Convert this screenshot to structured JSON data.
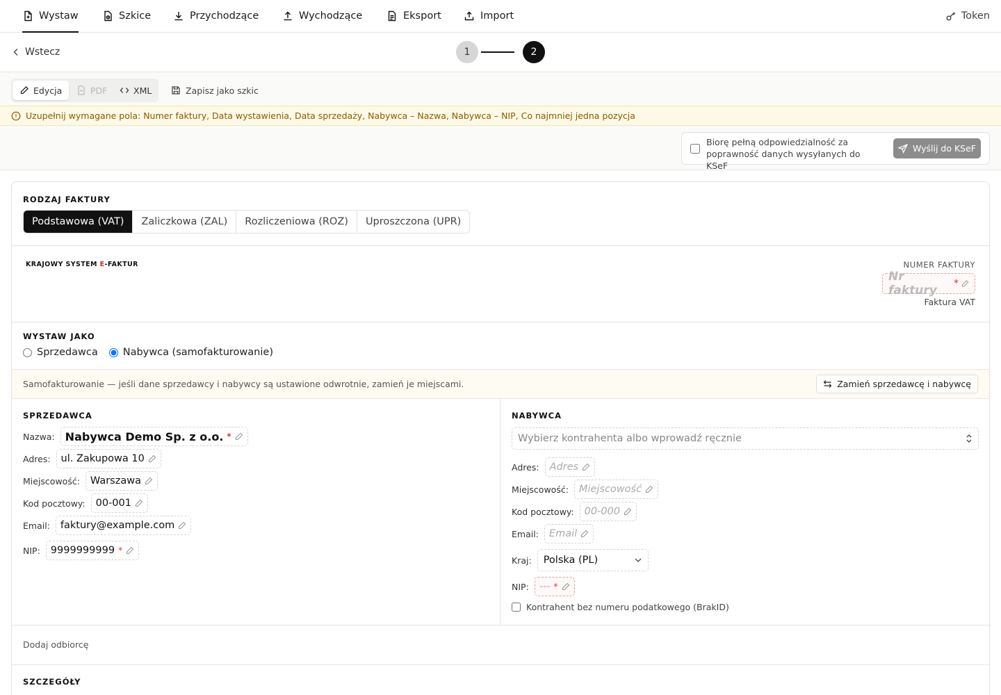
{
  "nav": {
    "tabs": [
      {
        "label": "Wystaw",
        "icon": "file-plus-icon"
      },
      {
        "label": "Szkice",
        "icon": "draft-icon"
      },
      {
        "label": "Przychodzące",
        "icon": "download-icon"
      },
      {
        "label": "Wychodzące",
        "icon": "upload-icon"
      },
      {
        "label": "Eksport",
        "icon": "file-text-icon"
      },
      {
        "label": "Import",
        "icon": "import-icon"
      }
    ],
    "token_label": "Token"
  },
  "back_label": "Wstecz",
  "steps": [
    "1",
    "2"
  ],
  "toolbar": {
    "edit_label": "Edycja",
    "pdf_label": "PDF",
    "xml_label": "XML",
    "save_draft_label": "Zapisz jako szkic"
  },
  "warning": "Uzupełnij wymagane pola: Numer faktury, Data wystawienia, Data sprzedaży, Nabywca – Nazwa, Nabywca – NIP, Co najmniej jedna pozycja",
  "confirm": {
    "text": "Biorę pełną odpowiedzialność za poprawność danych wysyłanych do KSeF",
    "checked": false,
    "send_label": "Wyślij do KSeF"
  },
  "invoice_type": {
    "title": "RODZAJ FAKTURY",
    "options": [
      "Podstawowa (VAT)",
      "Zaliczkowa (ZAL)",
      "Rozliczeniowa (ROZ)",
      "Uproszczona (UPR)"
    ],
    "selected": "Podstawowa (VAT)"
  },
  "ksef_logo": {
    "before": "KRAJOWY SYSTEM ",
    "e": "E",
    "after": "-FAKTUR"
  },
  "invoice_number": {
    "label": "NUMER FAKTURY",
    "placeholder": "Nr faktury",
    "required_mark": "*",
    "subtitle": "Faktura VAT"
  },
  "issue_as": {
    "title": "WYSTAW JAKO",
    "options": [
      "Sprzedawca",
      "Nabywca (samofakturowanie)"
    ],
    "selected": "Nabywca (samofakturowanie)"
  },
  "self_billing": {
    "note": "Samofakturowanie — jeśli dane sprzedawcy i nabywcy są ustawione odwrotnie, zamień je miejscami.",
    "swap_label": "Zamień sprzedawcę i nabywcę"
  },
  "seller": {
    "title": "SPRZEDAWCA",
    "name_label": "Nazwa:",
    "name": "Nabywca Demo Sp. z o.o.",
    "address_label": "Adres:",
    "address": "ul. Zakupowa 10",
    "city_label": "Miejscowość:",
    "city": "Warszawa",
    "postal_label": "Kod pocztowy:",
    "postal": "00-001",
    "email_label": "Email:",
    "email": "faktury@example.com",
    "nip_label": "NIP:",
    "nip": "9999999999",
    "required_mark": "*"
  },
  "buyer": {
    "title": "NABYWCA",
    "select_placeholder": "Wybierz kontrahenta albo wprowadź ręcznie",
    "address_label": "Adres:",
    "address_ph": "Adres",
    "city_label": "Miejscowość:",
    "city_ph": "Miejscowość",
    "postal_label": "Kod pocztowy:",
    "postal_ph": "00-000",
    "email_label": "Email:",
    "email_ph": "Email",
    "country_label": "Kraj:",
    "country": "Polska (PL)",
    "nip_label": "NIP:",
    "nip_ph": "---",
    "required_mark": "*",
    "brakid_label": "Kontrahent bez numeru podatkowego (BrakID)",
    "brakid_checked": false
  },
  "add_recipient_label": "Dodaj odbiorcę",
  "details_title": "SZCZEGÓŁY"
}
